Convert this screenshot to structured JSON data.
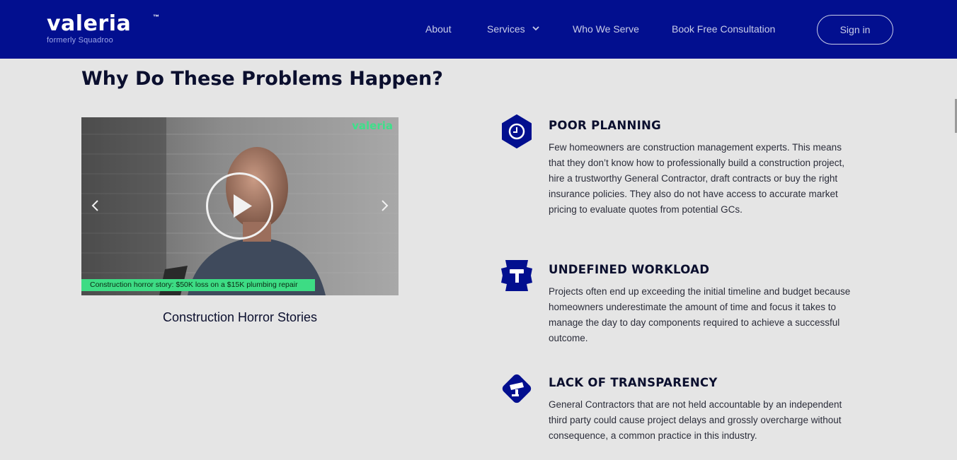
{
  "header": {
    "logo_text": "valeria",
    "logo_tm": "™",
    "logo_subtitle": "formerly Squadroo",
    "nav": [
      {
        "label": "About"
      },
      {
        "label": "Services",
        "icon": "chevron-down-icon"
      },
      {
        "label": "Who We Serve"
      },
      {
        "label": "Book Free Consultation"
      }
    ],
    "signin_label": "Sign in"
  },
  "section": {
    "title": "Why Do These Problems Happen?"
  },
  "video": {
    "watermark": "valeria",
    "caption": "Construction horror story: $50K loss on a $15K plumbing repair",
    "title": "Construction Horror Stories",
    "caption_color": "#3ddc84"
  },
  "problems": [
    {
      "icon": "clock-icon",
      "title": "POOR PLANNING",
      "text": "Few homeowners are construction management experts. This means that they don’t know how to professionally build a construction project, hire a trustworthy General Contractor, draft contracts or buy the right insurance policies. They also do not have access to accurate market pricing to evaluate quotes from potential GCs."
    },
    {
      "icon": "hammer-icon",
      "title": "UNDEFINED WORKLOAD",
      "text": "Projects often end up exceeding the initial timeline and budget because homeowners underestimate the amount of time and focus it takes to manage the day to day components required to achieve a successful outcome."
    },
    {
      "icon": "cctv-camera-icon",
      "title": "LACK OF TRANSPARENCY",
      "text": "General Contractors that are not held accountable by an independent third party could cause project delays and grossly overcharge without consequence, a common practice in this industry."
    }
  ],
  "colors": {
    "header_bg": "#020f8f",
    "page_bg": "#e5e5e5",
    "heading": "#0b0f2e",
    "icon_bg": "#020f8f"
  }
}
